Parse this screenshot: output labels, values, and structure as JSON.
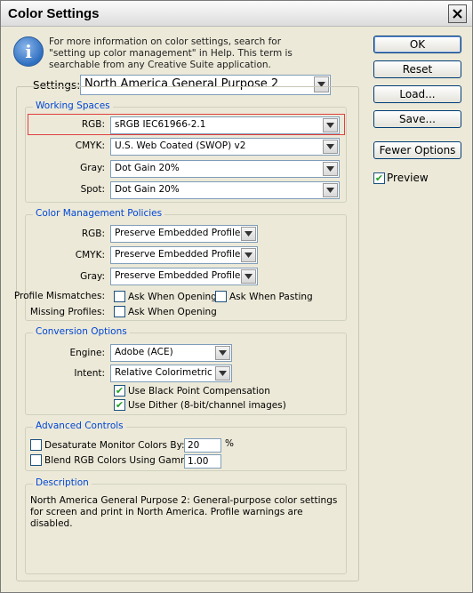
{
  "window": {
    "title": "Color Settings"
  },
  "info": {
    "text": "For more information on color settings, search for \"setting up color management\" in Help. This term is searchable from any Creative Suite application."
  },
  "settings": {
    "label": "Settings:",
    "value": "North America General Purpose 2"
  },
  "working_spaces": {
    "title": "Working Spaces",
    "rgb": {
      "label": "RGB:",
      "value": "sRGB IEC61966-2.1"
    },
    "cmyk": {
      "label": "CMYK:",
      "value": "U.S. Web Coated (SWOP) v2"
    },
    "gray": {
      "label": "Gray:",
      "value": "Dot Gain 20%"
    },
    "spot": {
      "label": "Spot:",
      "value": "Dot Gain 20%"
    }
  },
  "policies": {
    "title": "Color Management Policies",
    "rgb": {
      "label": "RGB:",
      "value": "Preserve Embedded Profiles"
    },
    "cmyk": {
      "label": "CMYK:",
      "value": "Preserve Embedded Profiles"
    },
    "gray": {
      "label": "Gray:",
      "value": "Preserve Embedded Profiles"
    },
    "profile_mismatches": {
      "label": "Profile Mismatches:",
      "ask_opening": "Ask When Opening",
      "ask_pasting": "Ask When Pasting",
      "ask_opening_checked": false,
      "ask_pasting_checked": false
    },
    "missing_profiles": {
      "label": "Missing Profiles:",
      "ask_opening": "Ask When Opening",
      "ask_opening_checked": false
    }
  },
  "conversion": {
    "title": "Conversion Options",
    "engine": {
      "label": "Engine:",
      "value": "Adobe (ACE)"
    },
    "intent": {
      "label": "Intent:",
      "value": "Relative Colorimetric"
    },
    "black_point": {
      "label": "Use Black Point Compensation",
      "checked": true
    },
    "dither": {
      "label": "Use Dither (8-bit/channel images)",
      "checked": true
    }
  },
  "advanced": {
    "title": "Advanced Controls",
    "desaturate": {
      "label": "Desaturate Monitor Colors By:",
      "value": "20",
      "unit": "%",
      "checked": false
    },
    "blend": {
      "label": "Blend RGB Colors Using Gamma:",
      "value": "1.00",
      "checked": false
    }
  },
  "description": {
    "title": "Description",
    "text": "North America General Purpose 2:  General-purpose color settings for screen and print in North America. Profile warnings are disabled."
  },
  "buttons": {
    "ok": "OK",
    "reset": "Reset",
    "load": "Load...",
    "save": "Save...",
    "fewer_options": "Fewer Options"
  },
  "preview": {
    "label": "Preview",
    "checked": true
  },
  "colors": {
    "group_title": "#0046d5",
    "highlight": "#e0403f",
    "check": "#21a121"
  }
}
